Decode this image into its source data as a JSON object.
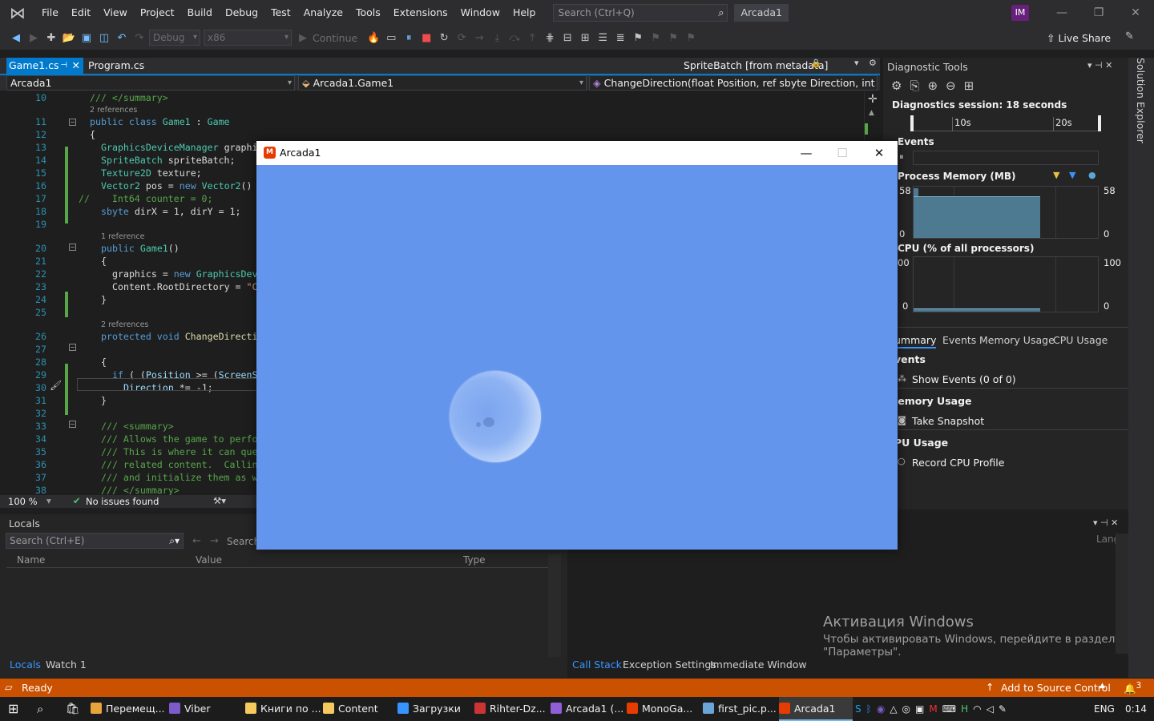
{
  "menu": [
    "File",
    "Edit",
    "View",
    "Project",
    "Build",
    "Debug",
    "Test",
    "Analyze",
    "Tools",
    "Extensions",
    "Window",
    "Help"
  ],
  "search": {
    "placeholder": "Search (Ctrl+Q)"
  },
  "project_title": "Arcada1",
  "user_initials": "IM",
  "toolbar": {
    "config": "Debug",
    "platform": "x86",
    "continue_label": "Continue",
    "live_share": "Live Share"
  },
  "tabs": {
    "active": "Game1.cs",
    "inactive": "Program.cs",
    "meta": "SpriteBatch [from metadata]"
  },
  "navbar": {
    "project": "Arcada1",
    "class": "Arcada1.Game1",
    "member": "ChangeDirection(float Position, ref sbyte Direction, int ScreenSize)"
  },
  "code": {
    "lines": [
      {
        "n": "10",
        "segs": [
          {
            "c": "c",
            "t": "/// </summary>"
          }
        ],
        "indent": 0
      },
      {
        "ref": "2 references",
        "indent": 0
      },
      {
        "n": "11",
        "segs": [
          {
            "c": "k",
            "t": "public class "
          },
          {
            "c": "t",
            "t": "Game1"
          },
          {
            "c": "",
            "t": " : "
          },
          {
            "c": "t",
            "t": "Game"
          }
        ],
        "indent": 0
      },
      {
        "n": "12",
        "segs": [
          {
            "c": "",
            "t": "{"
          }
        ],
        "indent": 0
      },
      {
        "n": "13",
        "segs": [
          {
            "c": "t",
            "t": "GraphicsDeviceManager"
          },
          {
            "c": "",
            "t": " graphics;"
          }
        ],
        "indent": 1
      },
      {
        "n": "14",
        "segs": [
          {
            "c": "t",
            "t": "SpriteBatch"
          },
          {
            "c": "",
            "t": " spriteBatch;"
          }
        ],
        "indent": 1
      },
      {
        "n": "15",
        "segs": [
          {
            "c": "t",
            "t": "Texture2D"
          },
          {
            "c": "",
            "t": " texture;"
          }
        ],
        "indent": 1
      },
      {
        "n": "16",
        "segs": [
          {
            "c": "t",
            "t": "Vector2"
          },
          {
            "c": "",
            "t": " pos = "
          },
          {
            "c": "k",
            "t": "new "
          },
          {
            "c": "t",
            "t": "Vector2"
          },
          {
            "c": "",
            "t": "()"
          }
        ],
        "indent": 1
      },
      {
        "n": "17",
        "segs": [
          {
            "c": "c",
            "t": "//    Int64 counter = 0;"
          }
        ],
        "indent": 0
      },
      {
        "n": "18",
        "segs": [
          {
            "c": "k",
            "t": "sbyte"
          },
          {
            "c": "",
            "t": " dirX = 1, dirY = 1;"
          }
        ],
        "indent": 1
      },
      {
        "n": "19",
        "segs": [],
        "indent": 0
      },
      {
        "ref": "1 reference",
        "indent": 1
      },
      {
        "n": "20",
        "segs": [
          {
            "c": "k",
            "t": "public "
          },
          {
            "c": "t",
            "t": "Game1"
          },
          {
            "c": "",
            "t": "()"
          }
        ],
        "indent": 1
      },
      {
        "n": "21",
        "segs": [
          {
            "c": "",
            "t": "{"
          }
        ],
        "indent": 1
      },
      {
        "n": "22",
        "segs": [
          {
            "c": "",
            "t": "graphics = "
          },
          {
            "c": "k",
            "t": "new "
          },
          {
            "c": "t",
            "t": "GraphicsDeviceManager"
          }
        ],
        "indent": 2
      },
      {
        "n": "23",
        "segs": [
          {
            "c": "",
            "t": "Content.RootDirectory = "
          },
          {
            "c": "s",
            "t": "\"Content\""
          }
        ],
        "indent": 2
      },
      {
        "n": "24",
        "segs": [
          {
            "c": "",
            "t": "}"
          }
        ],
        "indent": 1
      },
      {
        "n": "25",
        "segs": [],
        "indent": 0
      },
      {
        "ref": "2 references",
        "indent": 1
      },
      {
        "n": "26",
        "segs": [
          {
            "c": "k",
            "t": "protected void "
          },
          {
            "c": "m",
            "t": "ChangeDirection"
          }
        ],
        "indent": 1
      },
      {
        "n": "27",
        "segs": [],
        "indent": 0
      },
      {
        "n": "28",
        "segs": [
          {
            "c": "",
            "t": "{"
          }
        ],
        "indent": 1
      },
      {
        "n": "29",
        "segs": [
          {
            "c": "k",
            "t": "if"
          },
          {
            "c": "",
            "t": " ( ("
          },
          {
            "c": "p",
            "t": "Position"
          },
          {
            "c": "",
            "t": " >= ("
          },
          {
            "c": "p",
            "t": "ScreenSize"
          }
        ],
        "indent": 2
      },
      {
        "n": "30",
        "segs": [
          {
            "c": "p",
            "t": "Direction"
          },
          {
            "c": "",
            "t": " *= -1;"
          }
        ],
        "indent": 3
      },
      {
        "n": "31",
        "segs": [
          {
            "c": "",
            "t": "}"
          }
        ],
        "indent": 1
      },
      {
        "n": "32",
        "segs": [],
        "indent": 0
      },
      {
        "n": "33",
        "segs": [
          {
            "c": "c",
            "t": "/// <summary>"
          }
        ],
        "indent": 1
      },
      {
        "n": "34",
        "segs": [
          {
            "c": "c",
            "t": "/// Allows the game to perform"
          }
        ],
        "indent": 1
      },
      {
        "n": "35",
        "segs": [
          {
            "c": "c",
            "t": "/// This is where it can query"
          }
        ],
        "indent": 1
      },
      {
        "n": "36",
        "segs": [
          {
            "c": "c",
            "t": "/// related content.  Calling"
          }
        ],
        "indent": 1
      },
      {
        "n": "37",
        "segs": [
          {
            "c": "c",
            "t": "/// and initialize them as well"
          }
        ],
        "indent": 1
      },
      {
        "n": "38",
        "segs": [
          {
            "c": "c",
            "t": "/// </summary>"
          }
        ],
        "indent": 1
      }
    ]
  },
  "code_status": {
    "zoom": "100 %",
    "issues": "No issues found"
  },
  "locals": {
    "title": "Locals",
    "search_placeholder": "Search (Ctrl+E)",
    "search2": "Search",
    "col_name": "Name",
    "col_value": "Value",
    "col_type": "Type",
    "tab_locals": "Locals",
    "tab_watch": "Watch 1"
  },
  "callstack": {
    "col_lang": "Lang",
    "tab_callstack": "Call Stack",
    "tab_exceptions": "Exception Settings",
    "tab_immediate": "Immediate Window"
  },
  "activation": {
    "title": "Активация Windows",
    "line1": "Чтобы активировать Windows, перейдите в раздел",
    "line2": "\"Параметры\"."
  },
  "diag": {
    "title": "Diagnostic Tools",
    "session": "Diagnostics session: 18 seconds",
    "tick_10": "10s",
    "tick_20": "20s",
    "events_label": "Events",
    "mem_title": "Process Memory (MB)",
    "mem_max": "58",
    "mem_min": "0",
    "cpu_title": "CPU (% of all processors)",
    "cpu_max": "100",
    "cpu_max_left": "00",
    "cpu_min": "0",
    "tabs": [
      "ummary",
      "Events",
      "Memory Usage",
      "CPU Usage"
    ],
    "sec_events": "vents",
    "show_events": "Show Events (0 of 0)",
    "sec_memory": "lemory Usage",
    "take_snapshot": "Take Snapshot",
    "sec_cpu": "PU Usage",
    "record_cpu": "Record CPU Profile"
  },
  "solution_explorer": "Solution Explorer",
  "game": {
    "title": "Arcada1",
    "background": "#6495ed"
  },
  "status": {
    "ready": "Ready",
    "source_control": "Add to Source Control",
    "notif": "3"
  },
  "taskbar": {
    "items": [
      "Перемещ...",
      "Viber",
      "Книги по ...",
      "Content",
      "Загрузки",
      "Rihter-Dz...",
      "Arcada1 (...",
      "MonoGa...",
      "first_pic.p...",
      "Arcada1"
    ],
    "lang": "ENG",
    "time": "0:14"
  },
  "colors": {
    "accent": "#007acc",
    "status_bar": "#ca5100",
    "editor_bg": "#1e1e1e"
  }
}
